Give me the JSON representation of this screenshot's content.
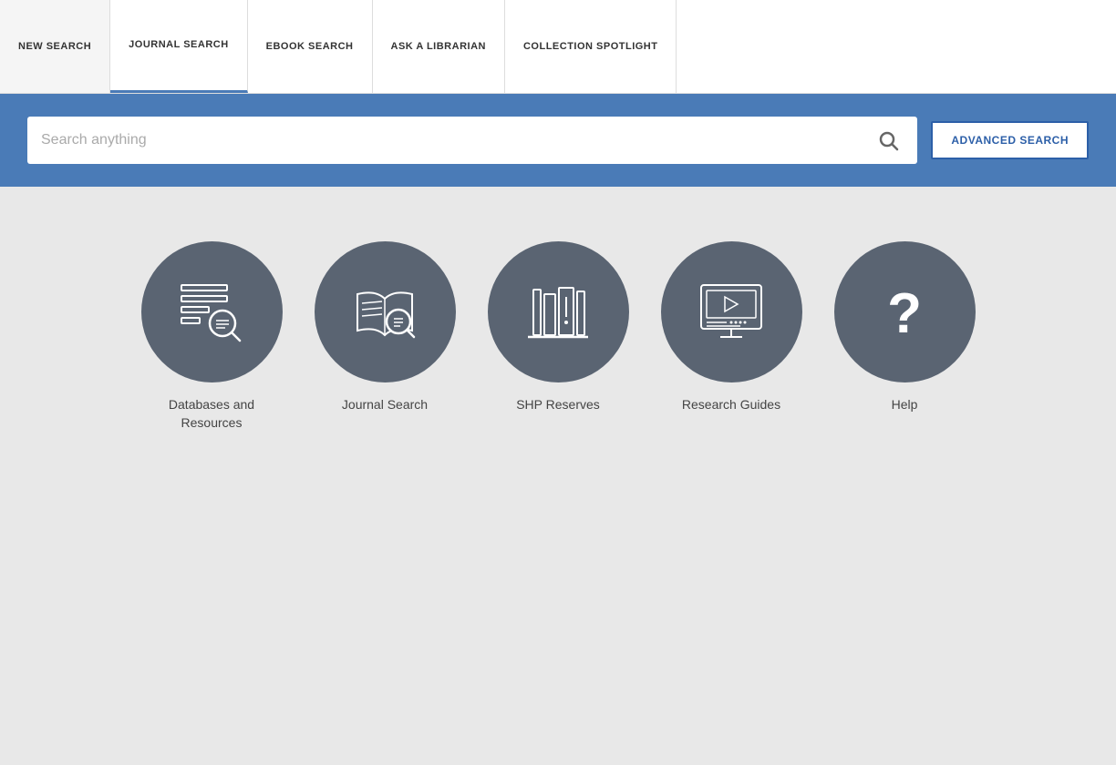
{
  "nav": {
    "items": [
      {
        "id": "new-search",
        "label": "NEW SEARCH",
        "active": false
      },
      {
        "id": "journal-search",
        "label": "JOURNAL SEARCH",
        "active": true
      },
      {
        "id": "ebook-search",
        "label": "EBOOK SEARCH",
        "active": false
      },
      {
        "id": "ask-librarian",
        "label": "ASK A LIBRARIAN",
        "active": false
      },
      {
        "id": "collection-spotlight",
        "label": "COLLECTION SPOTLIGHT",
        "active": false
      }
    ]
  },
  "search": {
    "placeholder": "Search anything",
    "advanced_label": "ADVANCED SEARCH"
  },
  "icons": [
    {
      "id": "databases",
      "label": "Databases and Resources"
    },
    {
      "id": "journal",
      "label": "Journal Search"
    },
    {
      "id": "shp",
      "label": "SHP Reserves"
    },
    {
      "id": "research",
      "label": "Research Guides"
    },
    {
      "id": "help",
      "label": "Help"
    }
  ],
  "colors": {
    "nav_bg": "#ffffff",
    "search_bg": "#4a7bb7",
    "icon_circle": "#5a6472",
    "page_bg": "#e8e8e8",
    "active_border": "#4a7bb7"
  }
}
